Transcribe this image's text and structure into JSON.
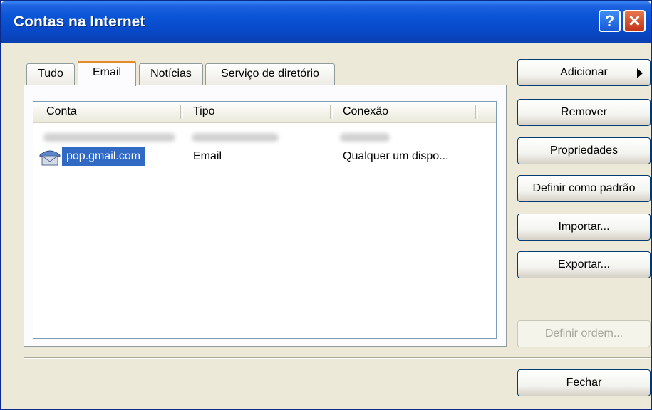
{
  "window": {
    "title": "Contas na Internet",
    "help_glyph": "?",
    "close_glyph": "✕"
  },
  "tabs": [
    {
      "label": "Tudo"
    },
    {
      "label": "Email"
    },
    {
      "label": "Notícias"
    },
    {
      "label": "Serviço de diretório"
    }
  ],
  "active_tab": "Email",
  "list": {
    "columns": [
      "Conta",
      "Tipo",
      "Conexão"
    ],
    "rows": [
      {
        "account": "pop.gmail.com",
        "type": "Email",
        "connection": "Qualquer um dispo...",
        "selected": true,
        "icon": "email-account-icon"
      }
    ]
  },
  "buttons": {
    "add": "Adicionar",
    "remove": "Remover",
    "properties": "Propriedades",
    "set_default": "Definir como padrão",
    "import": "Importar...",
    "export": "Exportar...",
    "set_order": "Definir ordem...",
    "close": "Fechar"
  },
  "colors": {
    "titlebar": "#0a55d8",
    "selection": "#316ac5",
    "active_tab_accent": "#e68b2c",
    "dialog_bg": "#ece9d8"
  }
}
